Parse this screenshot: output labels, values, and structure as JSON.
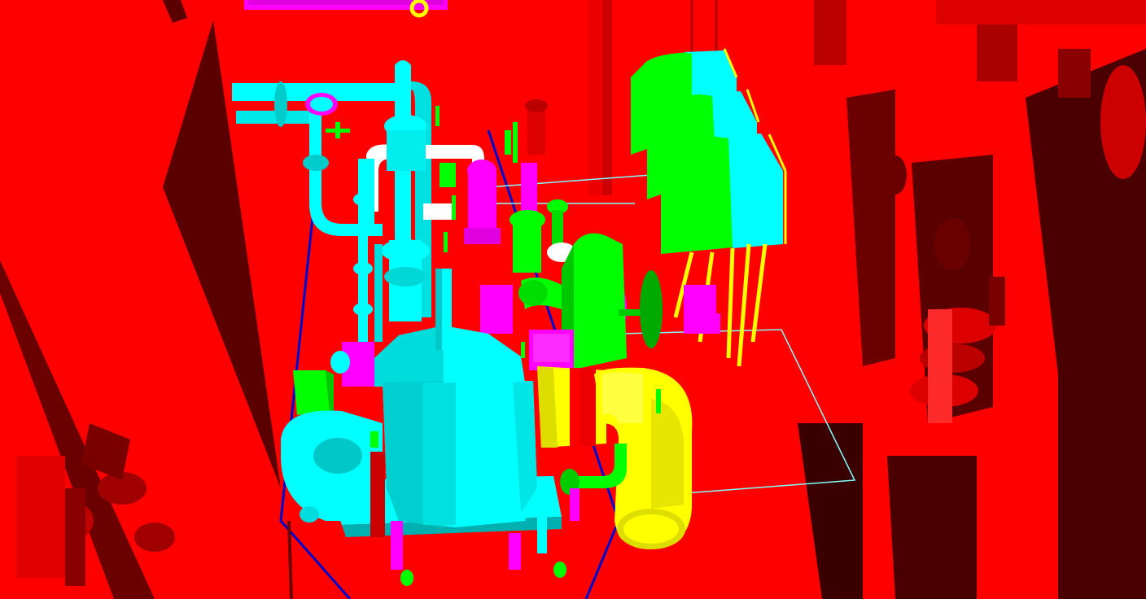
{
  "viewport": {
    "title": "",
    "colors": {
      "structure": "#ff0000",
      "structure_shadow": "#5a0000",
      "structure_dark": "#3a0000",
      "piping_cyan": "#00ffff",
      "piping_cyan_shade": "#00c8c8",
      "equipment_green": "#00ff00",
      "equipment_green_shade": "#00b400",
      "valve_magenta": "#ff00ff",
      "pipe_yellow": "#ffff00",
      "pipe_yellow_shade": "#c8c800",
      "pipe_white": "#ffffff",
      "outline_blue": "#0000cc"
    },
    "objects": [
      "left-wall-panel",
      "right-wall-panel",
      "green-cabinet-stack",
      "main-pump-vessel",
      "yellow-discharge-elbow",
      "green-motor",
      "cyan-overhead-pipe"
    ]
  }
}
